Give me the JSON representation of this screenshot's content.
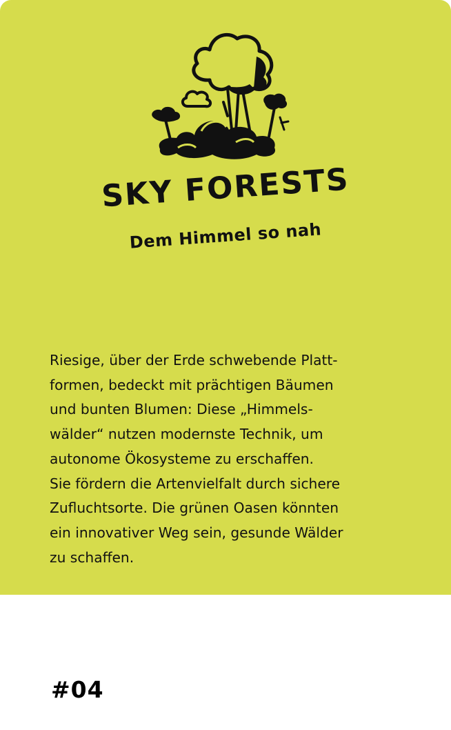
{
  "card": {
    "title": "SKY FORESTS",
    "subtitle": "Dem Himmel so nah",
    "body": "Riesige, über der Erde schwebende Platt-\nformen, bedeckt mit prächtigen Bäumen\nund bunten Blumen: Diese „Himmels-\nwälder“ nutzen modernste Technik, um\nautonome Ökosysteme zu erschaffen.\nSie fördern die Artenvielfalt durch sichere\nZufluchtsorte. Die grünen Oasen könnten\nein innovativer Weg sein, gesunde Wälder\nzu schaffen.",
    "number": "#04",
    "icon": "sky-forest-illustration",
    "colors": {
      "background": "#d6dc4c",
      "text": "#111111",
      "footer": "#ffffff"
    }
  }
}
